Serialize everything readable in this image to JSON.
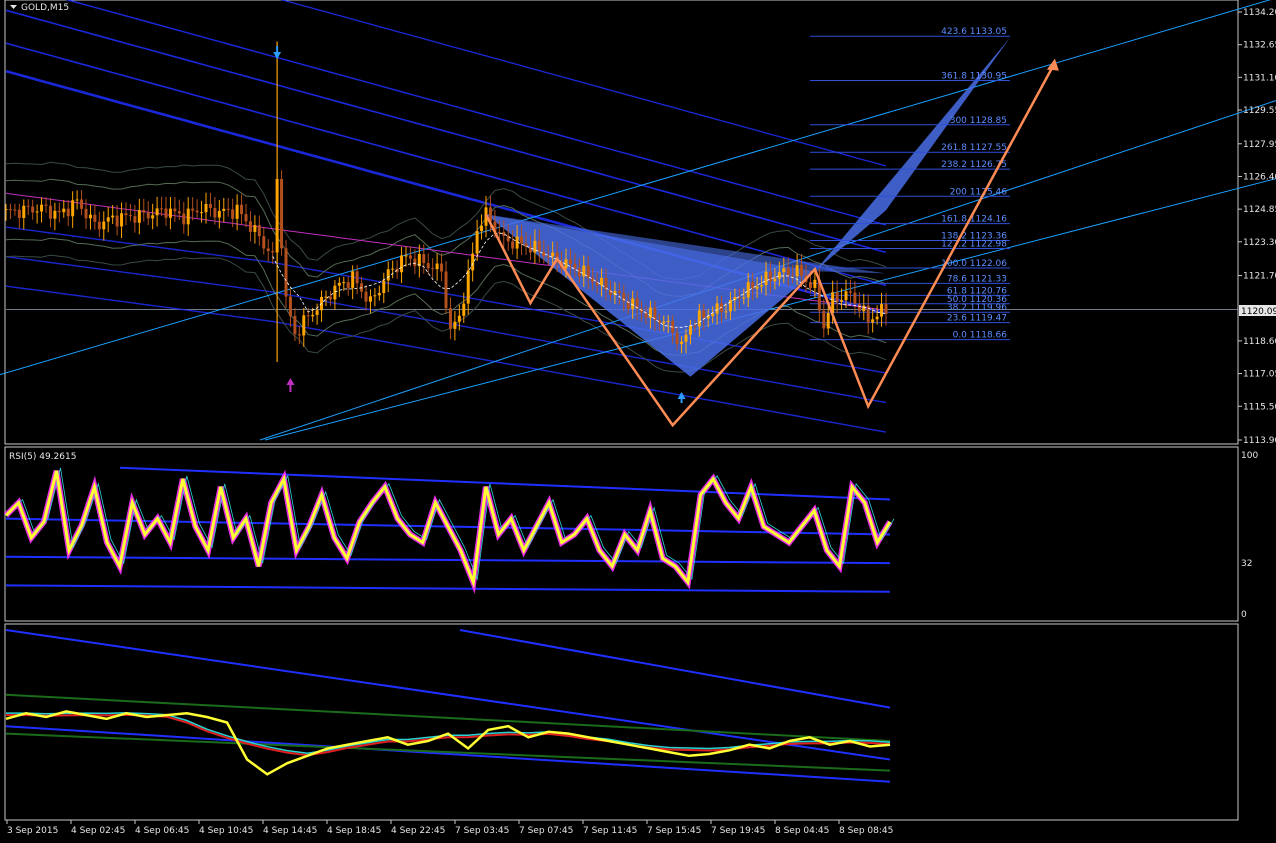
{
  "window": {
    "symbol_label": "GOLD,M15",
    "current_price": "1120.09",
    "rsi_label": "RSI(5) 49.2615"
  },
  "colors": {
    "background": "#000000",
    "frame": "#c8c8c8",
    "bull_candle": "#ffa500",
    "bear_candle": "#b4501e",
    "blue_band": "#1f2fff",
    "pattern_fill": "#4a6ee8",
    "zigzag": "#ff8c55",
    "cyan_line": "#1aa0ff",
    "rsi_line": "#ffff33",
    "rsi_glow": "#ff33ff"
  },
  "chart_data": [
    {
      "type": "candlestick",
      "title": "GOLD,M15",
      "ylim": [
        1113.9,
        1134.6
      ],
      "y_ticks": [
        "1134.20",
        "1132.65",
        "1131.10",
        "1129.55",
        "1127.95",
        "1126.40",
        "1124.85",
        "1123.30",
        "1121.70",
        "1120.09",
        "1118.60",
        "1117.05",
        "1115.50",
        "1113.90"
      ],
      "x_ticks": [
        "3 Sep 2015",
        "4 Sep 02:45",
        "4 Sep 06:45",
        "4 Sep 10:45",
        "4 Sep 14:45",
        "4 Sep 18:45",
        "4 Sep 22:45",
        "7 Sep 03:45",
        "7 Sep 07:45",
        "7 Sep 11:45",
        "7 Sep 15:45",
        "7 Sep 19:45",
        "8 Sep 04:45",
        "8 Sep 08:45"
      ],
      "close_path": [
        [
          0,
          1124.7
        ],
        [
          4,
          1124.8
        ],
        [
          8,
          1124.9
        ],
        [
          12,
          1124.6
        ],
        [
          16,
          1125.2
        ],
        [
          20,
          1124.1
        ],
        [
          24,
          1124.4
        ],
        [
          28,
          1124.5
        ],
        [
          32,
          1124.6
        ],
        [
          36,
          1124.8
        ],
        [
          40,
          1124.5
        ],
        [
          44,
          1124.9
        ],
        [
          48,
          1124.7
        ],
        [
          52,
          1124.8
        ],
        [
          56,
          1123.8
        ],
        [
          60,
          1122.6
        ],
        [
          61,
          1126.2
        ],
        [
          63,
          1120.5
        ],
        [
          65,
          1118.9
        ],
        [
          67,
          1119.5
        ],
        [
          70,
          1120.2
        ],
        [
          74,
          1121.1
        ],
        [
          78,
          1121.6
        ],
        [
          82,
          1120.4
        ],
        [
          86,
          1121.8
        ],
        [
          90,
          1122.6
        ],
        [
          94,
          1122.3
        ],
        [
          98,
          1121.9
        ],
        [
          100,
          1119.0
        ],
        [
          102,
          1119.8
        ],
        [
          104,
          1121.6
        ],
        [
          106,
          1123.9
        ],
        [
          108,
          1124.6
        ],
        [
          112,
          1123.4
        ],
        [
          116,
          1123.2
        ],
        [
          120,
          1122.9
        ],
        [
          124,
          1122.4
        ],
        [
          128,
          1122.1
        ],
        [
          132,
          1121.5
        ],
        [
          136,
          1121.0
        ],
        [
          140,
          1120.4
        ],
        [
          144,
          1119.9
        ],
        [
          148,
          1119.5
        ],
        [
          150,
          1119.1
        ],
        [
          152,
          1118.3
        ],
        [
          154,
          1119.4
        ],
        [
          158,
          1119.9
        ],
        [
          162,
          1120.2
        ],
        [
          166,
          1120.9
        ],
        [
          170,
          1121.4
        ],
        [
          174,
          1121.8
        ],
        [
          178,
          1121.9
        ],
        [
          182,
          1121.1
        ],
        [
          184,
          1119.3
        ],
        [
          186,
          1120.6
        ],
        [
          190,
          1120.8
        ],
        [
          194,
          1119.6
        ],
        [
          198,
          1120.1
        ]
      ],
      "fibonacci_levels": [
        {
          "ratio": "423.6",
          "price": "1133.05",
          "value": 1133.05
        },
        {
          "ratio": "361.8",
          "price": "1130.95",
          "value": 1130.95
        },
        {
          "ratio": "300",
          "price": "1128.85",
          "value": 1128.85
        },
        {
          "ratio": "261.8",
          "price": "1127.55",
          "value": 1127.55
        },
        {
          "ratio": "238.2",
          "price": "1126.75",
          "value": 1126.75
        },
        {
          "ratio": "200",
          "price": "1125.46",
          "value": 1125.46
        },
        {
          "ratio": "161.8",
          "price": "1124.16",
          "value": 1124.16
        },
        {
          "ratio": "138.2",
          "price": "1123.36",
          "value": 1123.36
        },
        {
          "ratio": "127.2",
          "price": "1122.98",
          "value": 1122.98
        },
        {
          "ratio": "100.0",
          "price": "1122.06",
          "value": 1122.06
        },
        {
          "ratio": "78.6",
          "price": "1121.33",
          "value": 1121.33
        },
        {
          "ratio": "61.8",
          "price": "1120.76",
          "value": 1120.76
        },
        {
          "ratio": "50.0",
          "price": "1120.36",
          "value": 1120.36
        },
        {
          "ratio": "38.2",
          "price": "1119.96",
          "value": 1119.96
        },
        {
          "ratio": "23.6",
          "price": "1119.47",
          "value": 1119.47
        },
        {
          "ratio": "0.0",
          "price": "1118.66",
          "value": 1118.66
        }
      ]
    },
    {
      "type": "line",
      "title": "RSI(5) 49.2615",
      "ylim": [
        0,
        100
      ],
      "y_ticks": [
        "100",
        "32",
        "0"
      ],
      "values": [
        62,
        70,
        48,
        58,
        90,
        40,
        56,
        80,
        45,
        30,
        70,
        50,
        60,
        45,
        85,
        55,
        40,
        80,
        48,
        60,
        30,
        70,
        85,
        40,
        55,
        75,
        48,
        35,
        58,
        70,
        80,
        60,
        50,
        45,
        70,
        55,
        40,
        20,
        80,
        50,
        60,
        40,
        55,
        70,
        45,
        50,
        60,
        40,
        30,
        50,
        40,
        65,
        35,
        30,
        20,
        75,
        85,
        70,
        60,
        80,
        55,
        50,
        45,
        55,
        65,
        40,
        30,
        80,
        70,
        45,
        58
      ]
    },
    {
      "type": "line",
      "title": "",
      "values": [
        52,
        55,
        53,
        56,
        54,
        52,
        55,
        53,
        54,
        55,
        53,
        50,
        30,
        22,
        28,
        32,
        36,
        38,
        40,
        42,
        38,
        40,
        44,
        36,
        46,
        48,
        42,
        45,
        44,
        42,
        40,
        38,
        36,
        34,
        32,
        33,
        35,
        38,
        36,
        40,
        42,
        38,
        40,
        37,
        38
      ]
    }
  ]
}
